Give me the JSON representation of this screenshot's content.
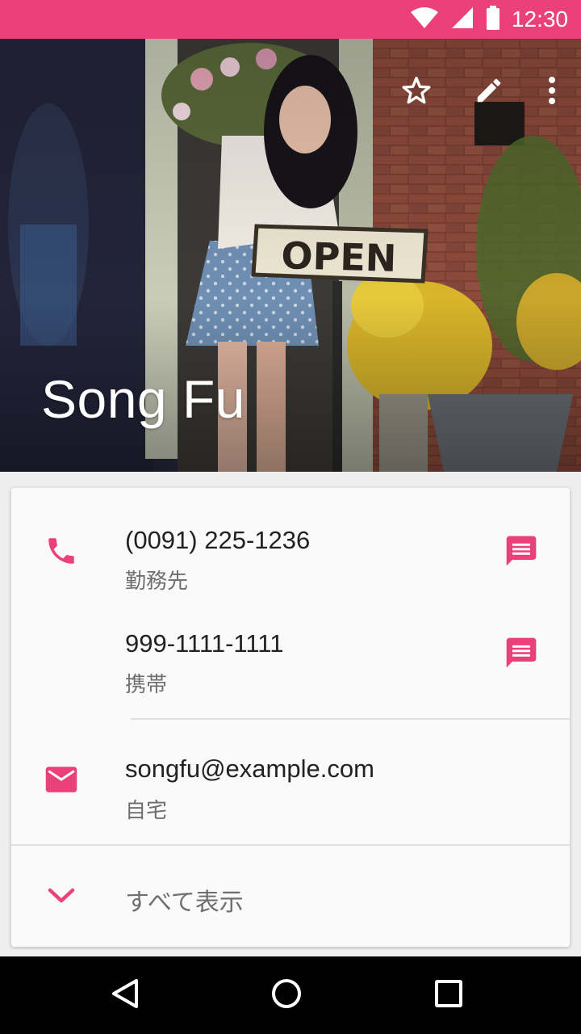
{
  "status_bar": {
    "time": "12:30"
  },
  "colors": {
    "accent": "#ec407a",
    "status_bar": "#ec407a",
    "card": "#fafafa",
    "nav_bar": "#000000"
  },
  "header": {
    "contact_name": "Song Fu",
    "actions": [
      {
        "icon": "star-outline-icon"
      },
      {
        "icon": "edit-pencil-icon"
      },
      {
        "icon": "more-vert-icon"
      }
    ]
  },
  "contact": {
    "phones": [
      {
        "number": "(0091) 225-1236",
        "type": "勤務先",
        "action_icon": "message-icon"
      },
      {
        "number": "999-1111-1111",
        "type": "携帯",
        "action_icon": "message-icon"
      }
    ],
    "emails": [
      {
        "address": "songfu@example.com",
        "type": "自宅"
      }
    ],
    "show_all_label": "すべて表示"
  },
  "nav_bar": {
    "buttons": [
      "back-icon",
      "home-icon",
      "recents-icon"
    ]
  }
}
